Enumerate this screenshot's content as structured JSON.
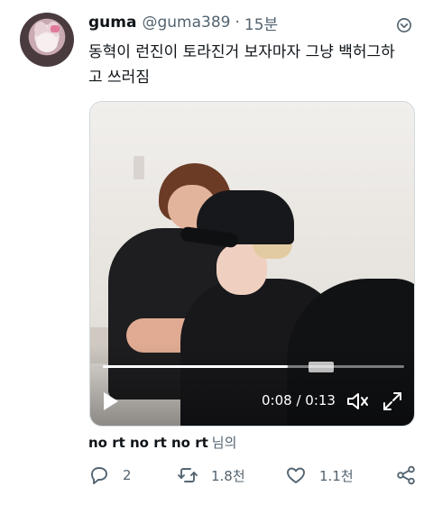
{
  "author": {
    "name": "guma",
    "handle": "@guma389",
    "separator": "·",
    "time": "15분"
  },
  "tweet": {
    "text_line1": "동혁이 런진이 토라진거 보자마자 그냥 백허그하",
    "text_line2": "고 쓰러짐"
  },
  "video": {
    "current_time": "0:08",
    "duration": "0:13",
    "time_readout": "0:08 / 0:13",
    "progress_fraction": 0.615
  },
  "viewer": {
    "name": "no rt no rt no rt",
    "suffix": "님의"
  },
  "actions": {
    "replies": "2",
    "retweets": "1.8천",
    "likes": "1.1천"
  },
  "colors": {
    "text_primary": "#0f1419",
    "text_secondary": "#536471",
    "border": "#cfd9de"
  },
  "icons": {
    "more": "more-dots-icon",
    "play": "play-icon",
    "volume": "volume-icon",
    "fullscreen": "fullscreen-icon",
    "reply": "reply-icon",
    "retweet": "retweet-icon",
    "like": "heart-icon",
    "share": "share-icon"
  }
}
